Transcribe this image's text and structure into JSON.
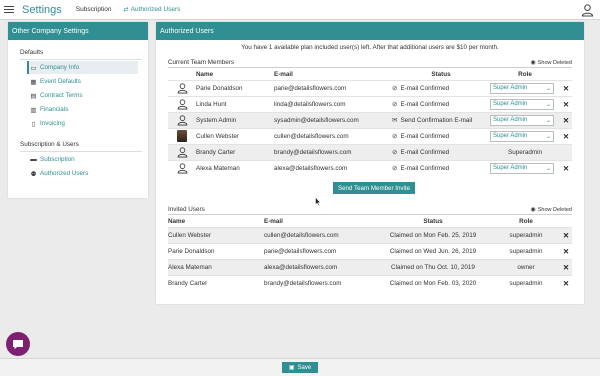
{
  "topbar": {
    "title": "Settings",
    "tabs": [
      {
        "label": "Subscription"
      },
      {
        "label": "Authorized Users"
      }
    ]
  },
  "sidebar": {
    "title": "Other Company Settings",
    "groups": [
      {
        "title": "Defaults",
        "items": [
          {
            "label": "Company Info",
            "icon": "id-card-icon"
          },
          {
            "label": "Event Defaults",
            "icon": "calendar-icon"
          },
          {
            "label": "Contract Terms",
            "icon": "document-icon"
          },
          {
            "label": "Financials",
            "icon": "ledger-icon"
          },
          {
            "label": "Invoicing",
            "icon": "file-text-icon"
          }
        ]
      },
      {
        "title": "Subscription & Users",
        "items": [
          {
            "label": "Subscription",
            "icon": "credit-card-icon"
          },
          {
            "label": "Authorized Users",
            "icon": "users-icon"
          }
        ]
      }
    ]
  },
  "main": {
    "title": "Authorized Users",
    "notice": "You have 1 available plan included user(s) left. After that additional users are $10 per month.",
    "current": {
      "title": "Current Team Members",
      "show_deleted": "Show Deleted",
      "columns": [
        "Name",
        "E-mail",
        "Status",
        "Role"
      ],
      "rows": [
        {
          "name": "Parie Donaldson",
          "email": "parie@detailsflowers.com",
          "status": "E-mail Confirmed",
          "role": "Super Admin",
          "editable": true
        },
        {
          "name": "Linda Hunt",
          "email": "linda@detailsflowers.com",
          "status": "E-mail Confirmed",
          "role": "Super Admin",
          "editable": true
        },
        {
          "name": "System Admin",
          "email": "sysadmin@detailsflowers.com",
          "status": "Send Confirmation E-mail",
          "role": "Super Admin",
          "editable": true
        },
        {
          "name": "Cullen Webster",
          "email": "cullen@detailsflowers.com",
          "status": "E-mail Confirmed",
          "role": "Super Admin",
          "editable": true
        },
        {
          "name": "Brandy Carter",
          "email": "brandy@detailsflowers.com",
          "status": "E-mail Confirmed",
          "role": "Superadmin",
          "editable": false
        },
        {
          "name": "Alexa Mateman",
          "email": "alexa@detailsflowers.com",
          "status": "E-mail Confirmed",
          "role": "Super Admin",
          "editable": true
        }
      ],
      "invite_label": "Send Team Member Invite"
    },
    "invited": {
      "title": "Invited Users",
      "show_deleted": "Show Deleted",
      "columns": [
        "Name",
        "E-mail",
        "Status",
        "Role"
      ],
      "rows": [
        {
          "name": "Cullen Webster",
          "email": "cullen@detailsflowers.com",
          "status": "Claimed on Mon Feb. 25, 2019",
          "role": "superadmin"
        },
        {
          "name": "Parie Donaldson",
          "email": "parie@detailsflowers.com",
          "status": "Claimed on Wed Jun. 26, 2019",
          "role": "superadmin"
        },
        {
          "name": "Alexa Mateman",
          "email": "alexa@detailsflowers.com",
          "status": "Claimed on Thu Oct. 10, 2019",
          "role": "owner"
        },
        {
          "name": "Brandy Carter",
          "email": "brandy@detailsflowers.com",
          "status": "Claimed on Mon Feb. 03, 2020",
          "role": "superadmin"
        }
      ]
    }
  },
  "footer": {
    "save_label": "Save"
  },
  "colors": {
    "accent": "#2f8f92",
    "chat": "#7e1f72"
  }
}
